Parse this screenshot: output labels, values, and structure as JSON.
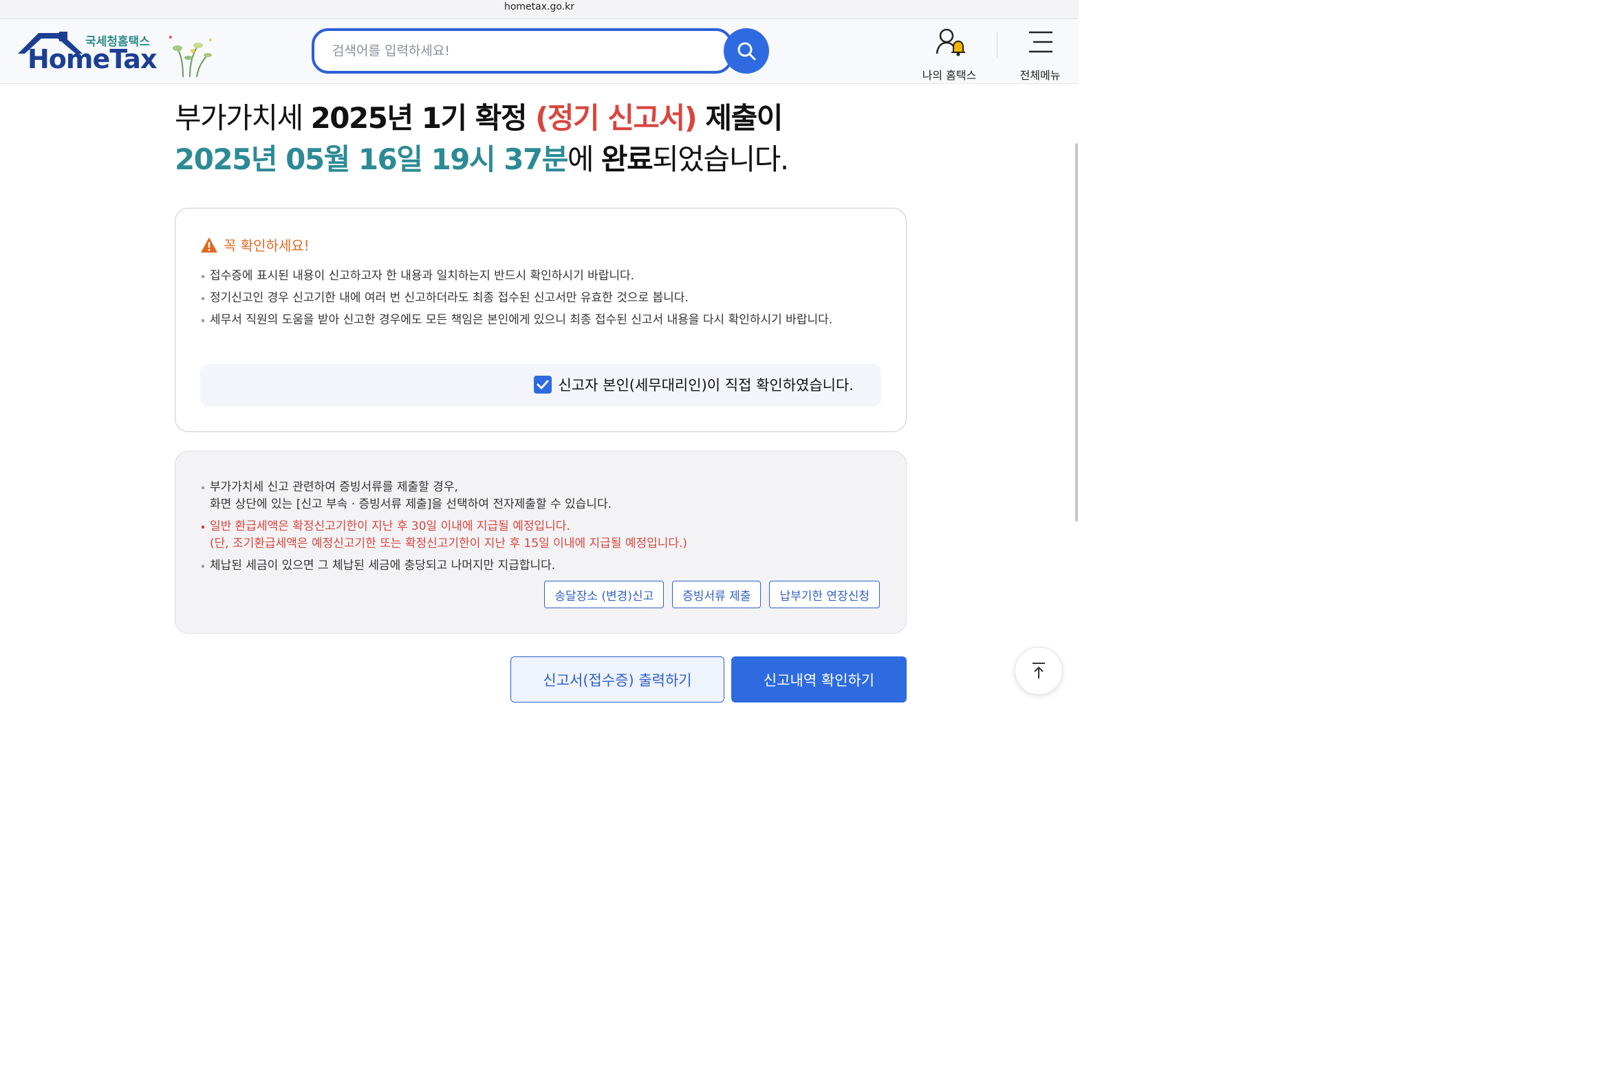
{
  "browser": {
    "url": "hometax.go.kr"
  },
  "header": {
    "logo_sub": "국세청홈택스",
    "logo_main": "HomeTax",
    "search_placeholder": "검색어를 입력하세요!",
    "my_hometax_label": "나의 홈택스",
    "all_menu_label": "전체메뉴"
  },
  "title": {
    "line1_prefix": "부가가치세 ",
    "line1_bold": "2025년 1기 확정 ",
    "line1_red": "(정기 신고서)",
    "line1_suffix": " 제출이",
    "line2_teal": "2025년 05월 16일 19시 37분",
    "line2_mid": "에 ",
    "line2_bold": "완료",
    "line2_end": "되었습니다."
  },
  "notice": {
    "heading": "꼭 확인하세요!",
    "items": [
      "접수증에 표시된 내용이 신고하고자 한 내용과 일치하는지 반드시 확인하시기 바랍니다.",
      "정기신고인 경우 신고기한 내에 여러 번 신고하더라도 최종 접수된 신고서만 유효한 것으로 봅니다.",
      "세무서 직원의 도움을 받아 신고한 경우에도 모든 책임은 본인에게 있으니 최종 접수된 신고서 내용을 다시 확인하시기 바랍니다."
    ],
    "confirm_label": "신고자 본인(세무대리인)이 직접 확인하였습니다.",
    "confirm_checked": true
  },
  "info": {
    "item1_line1": "부가가치세 신고 관련하여 증빙서류를 제출할 경우,",
    "item1_line2": "화면 상단에 있는 [신고 부속 · 증빙서류 제출]을 선택하여 전자제출할 수 있습니다.",
    "item2_line1": "일반 환급세액은 확정신고기한이 지난 후 30일 이내에 지급될 예정입니다.",
    "item2_line2": "(단, 조기환급세액은 예정신고기한 또는 확정신고기한이 지난 후 15일 이내에 지급될 예정입니다.)",
    "item3": "체납된 세금이 있으면 그 체납된 세금에 충당되고 나머지만 지급합니다.",
    "buttons": [
      "송달장소 (변경)신고",
      "증빙서류 제출",
      "납부기한 연장신청"
    ]
  },
  "actions": {
    "print_label": "신고서(접수증) 출력하기",
    "history_label": "신고내역 확인하기"
  },
  "colors": {
    "primary": "#2e6be0",
    "accent_red": "#d9453d",
    "accent_teal": "#2c8a95",
    "warning_orange": "#e06a22"
  }
}
